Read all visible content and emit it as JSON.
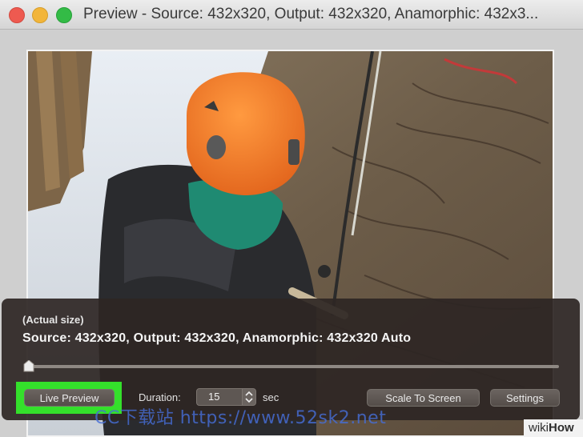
{
  "window": {
    "title": "Preview - Source: 432x320, Output: 432x320, Anamorphic: 432x3..."
  },
  "hud": {
    "size_label": "(Actual size)",
    "info": "Source: 432x320, Output: 432x320, Anamorphic: 432x320 Auto",
    "live_preview_label": "Live Preview",
    "duration_label": "Duration:",
    "duration_value": "15",
    "duration_unit": "sec",
    "scale_to_screen_label": "Scale To Screen",
    "settings_label": "Settings",
    "scrubber_position": 0.0
  },
  "overlay": {
    "watermark": "CC下载站  https://www.52sk2.net",
    "wikihow_prefix": "wiki",
    "wikihow_suffix": "How"
  },
  "colors": {
    "highlight": "#34e02b",
    "helmet": "#f07a2a",
    "scarf": "#1f8a72"
  }
}
